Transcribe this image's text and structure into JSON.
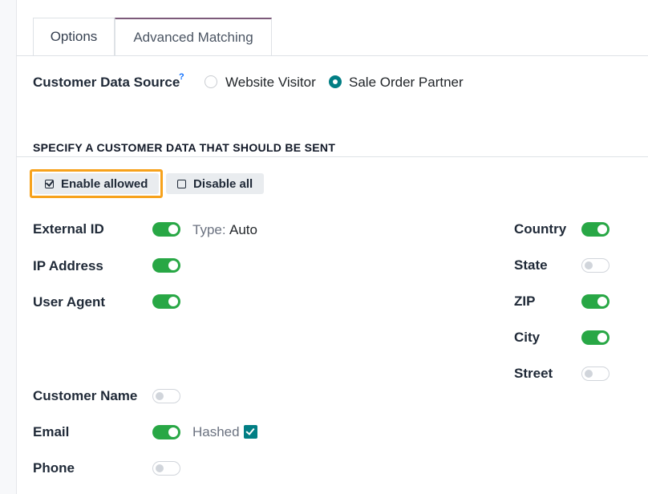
{
  "tabs": [
    {
      "label": "Options",
      "active": false
    },
    {
      "label": "Advanced Matching",
      "active": true
    }
  ],
  "customer_data_source": {
    "label": "Customer Data Source",
    "help_mark": "?",
    "options": [
      {
        "label": "Website Visitor",
        "selected": false
      },
      {
        "label": "Sale Order Partner",
        "selected": true
      }
    ]
  },
  "section": {
    "title": "SPECIFY A CUSTOMER DATA THAT SHOULD BE SENT"
  },
  "actions": {
    "enable_label": "Enable allowed",
    "disable_label": "Disable all"
  },
  "fields_left": [
    {
      "label": "External ID",
      "enabled": true
    },
    {
      "label": "IP Address",
      "enabled": true
    },
    {
      "label": "User Agent",
      "enabled": true
    },
    {
      "label": "Customer Name",
      "enabled": false
    },
    {
      "label": "Email",
      "enabled": true
    },
    {
      "label": "Phone",
      "enabled": false
    }
  ],
  "external_id_type": {
    "label": "Type:",
    "value": "Auto"
  },
  "email_hashed": {
    "label": "Hashed",
    "checked": true
  },
  "fields_right": [
    {
      "label": "Country",
      "enabled": true
    },
    {
      "label": "State",
      "enabled": false
    },
    {
      "label": "ZIP",
      "enabled": true
    },
    {
      "label": "City",
      "enabled": true
    },
    {
      "label": "Street",
      "enabled": false
    }
  ],
  "colors": {
    "accent": "#017e84",
    "toggle_on": "#28a745",
    "highlight": "#f7a21b",
    "tab_active": "#7c5a7a"
  }
}
